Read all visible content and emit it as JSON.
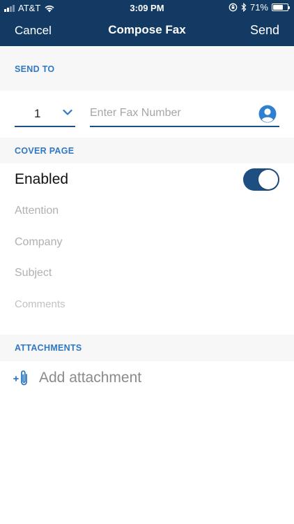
{
  "status_bar": {
    "carrier": "AT&T",
    "time": "3:09 PM",
    "battery_text": "71%",
    "battery_level": 0.71
  },
  "nav": {
    "cancel_label": "Cancel",
    "title": "Compose Fax",
    "send_label": "Send"
  },
  "send_to": {
    "header": "SEND TO",
    "country_code": "1",
    "fax_placeholder": "Enter Fax Number",
    "fax_value": ""
  },
  "cover_page": {
    "header": "COVER PAGE",
    "enabled_label": "Enabled",
    "enabled": true,
    "attention_placeholder": "Attention",
    "company_placeholder": "Company",
    "subject_placeholder": "Subject",
    "comments_placeholder": "Comments"
  },
  "attachments": {
    "header": "ATTACHMENTS",
    "add_label": "Add attachment"
  },
  "colors": {
    "header_bg": "#133a63",
    "accent": "#1e4f82",
    "section_label": "#2f78c4",
    "contact_icon": "#2f7fd0"
  }
}
